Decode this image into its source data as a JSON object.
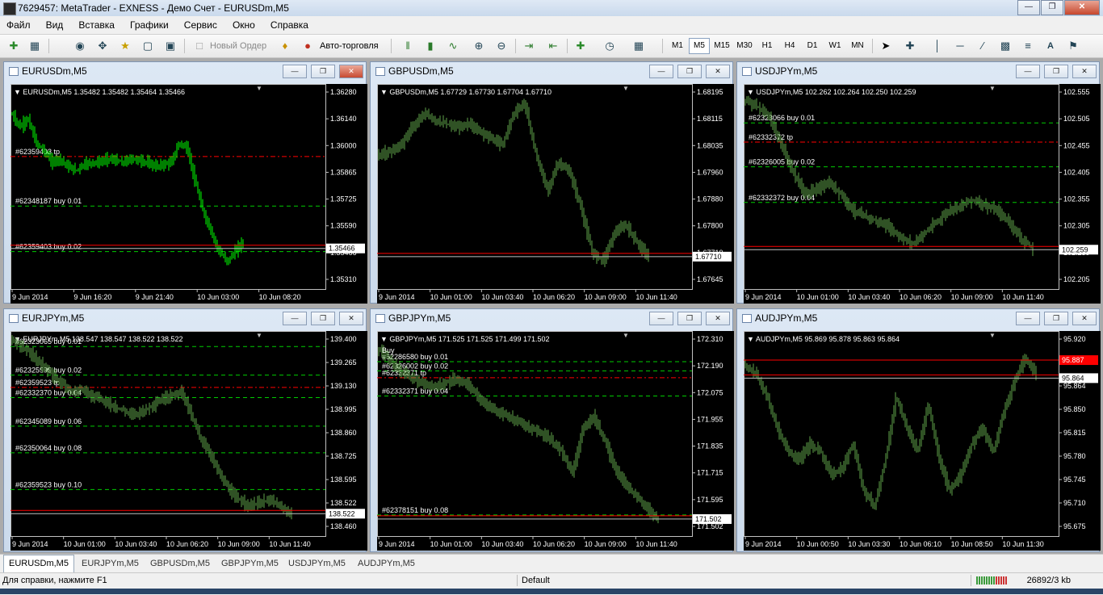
{
  "window": {
    "title": "7629457: MetaTrader - EXNESS - Демо Счет - EURUSDm,M5"
  },
  "menu": [
    "Файл",
    "Вид",
    "Вставка",
    "Графики",
    "Сервис",
    "Окно",
    "Справка"
  ],
  "toolbar": {
    "new_order": "Новый Ордер",
    "auto_trading": "Авто-торговля",
    "timeframes": [
      "M1",
      "M5",
      "M15",
      "M30",
      "H1",
      "H4",
      "D1",
      "W1",
      "MN"
    ],
    "active_timeframe": "M5"
  },
  "colors": {
    "bull": "#00ff00",
    "bear": "#00ff00",
    "chart_bg": "#000000",
    "grid": "#000000",
    "order_line": "#00cc00",
    "tp_line": "#ff0000",
    "bid_line": "#c0c0c0"
  },
  "charts": [
    {
      "title": "EURUSDm,M5",
      "info": "EURUSDm,M5  1.35482 1.35482 1.35464 1.35466",
      "line_color": "#00ff00",
      "yticks": [
        "1.36280",
        "1.36140",
        "1.36000",
        "1.35865",
        "1.35725",
        "1.35590",
        "1.35466",
        "1.35310"
      ],
      "ymin": 1.3531,
      "ymax": 1.3628,
      "xticks": [
        "9 Jun 2014",
        "9 Jun 16:20",
        "9 Jun 21:40",
        "10 Jun 03:00",
        "10 Jun 08:20"
      ],
      "price_label": "1.35466",
      "price_label_bg": "#ffffff",
      "price": 1.35466,
      "price_color": "#c0c0c0",
      "close_frac": 0.74,
      "levels": [
        {
          "label": "#62359403 tp",
          "value": 1.3593,
          "type": "tp"
        },
        {
          "label": "#62348187 buy 0.01",
          "value": 1.3568,
          "type": "order"
        },
        {
          "label": "#62359403 buy 0.02",
          "value": 1.3545,
          "type": "order"
        }
      ],
      "path": [
        1.3614,
        1.3608,
        1.3612,
        1.36,
        1.3596,
        1.359,
        1.3592,
        1.3588,
        1.3586,
        1.3589,
        1.359,
        1.359,
        1.3592,
        1.3591,
        1.359,
        1.3592,
        1.3591,
        1.359,
        1.3588,
        1.3589,
        1.359,
        1.36,
        1.3597,
        1.358,
        1.3565,
        1.3555,
        1.3545,
        1.354,
        1.3545,
        1.355
      ]
    },
    {
      "title": "GBPUSDm,M5",
      "info": "GBPUSDm,M5  1.67729 1.67730 1.67704 1.67710",
      "line_color": "#5fa44a",
      "yticks": [
        "1.68195",
        "1.68115",
        "1.68035",
        "1.67960",
        "1.67880",
        "1.67800",
        "1.67710",
        "1.67645"
      ],
      "ymin": 1.67645,
      "ymax": 1.68195,
      "xticks": [
        "9 Jun 2014",
        "10 Jun 01:00",
        "10 Jun 03:40",
        "10 Jun 06:20",
        "10 Jun 09:00",
        "10 Jun 11:40"
      ],
      "price_label": "1.67710",
      "price_label_bg": "#ffffff",
      "price": 1.6771,
      "price_color": "#c0c0c0",
      "close_frac": 0.86,
      "levels": [],
      "path": [
        1.68,
        1.6801,
        1.6803,
        1.6808,
        1.6812,
        1.681,
        1.6809,
        1.6808,
        1.6809,
        1.6807,
        1.6805,
        1.6803,
        1.6812,
        1.6815,
        1.68,
        1.679,
        1.6798,
        1.6795,
        1.6785,
        1.6772,
        1.677,
        1.6778,
        1.678,
        1.6775,
        1.6771
      ]
    },
    {
      "title": "USDJPYm,M5",
      "info": "USDJPYm,M5  102.262 102.264 102.250 102.259",
      "line_color": "#5fa44a",
      "yticks": [
        "102.555",
        "102.505",
        "102.455",
        "102.405",
        "102.355",
        "102.305",
        "102.259",
        "102.205"
      ],
      "ymin": 102.205,
      "ymax": 102.555,
      "xticks": [
        "9 Jun 2014",
        "10 Jun 01:00",
        "10 Jun 03:40",
        "10 Jun 06:20",
        "10 Jun 09:00",
        "10 Jun 11:40"
      ],
      "price_label": "102.259",
      "price_label_bg": "#ffffff",
      "price": 102.259,
      "price_color": "#c0c0c0",
      "close_frac": 0.92,
      "levels": [
        {
          "label": "#62323066 buy 0.01",
          "value": 102.49,
          "type": "order"
        },
        {
          "label": "#62332372 tp",
          "value": 102.455,
          "type": "tp"
        },
        {
          "label": "#62326005 buy 0.02",
          "value": 102.41,
          "type": "order"
        },
        {
          "label": "#62332372 buy 0.04",
          "value": 102.345,
          "type": "order"
        }
      ],
      "path": [
        102.53,
        102.52,
        102.5,
        102.45,
        102.4,
        102.36,
        102.37,
        102.38,
        102.36,
        102.33,
        102.32,
        102.31,
        102.3,
        102.28,
        102.27,
        102.29,
        102.31,
        102.33,
        102.34,
        102.35,
        102.34,
        102.33,
        102.31,
        102.28,
        102.26
      ]
    },
    {
      "title": "EURJPYm,M5",
      "info": "EURJPYm,M5  138.547 138.547 138.522 138.522",
      "line_color": "#5fa44a",
      "yticks": [
        "139.400",
        "139.265",
        "139.130",
        "138.995",
        "138.860",
        "138.725",
        "138.595",
        "138.522",
        "138.460"
      ],
      "ymin": 138.46,
      "ymax": 139.4,
      "xticks": [
        "9 Jun 2014",
        "10 Jun 01:00",
        "10 Jun 03:40",
        "10 Jun 06:20",
        "10 Jun 09:00",
        "10 Jun 11:40"
      ],
      "price_label": "138.522",
      "price_label_bg": "#ffffff",
      "price": 138.522,
      "price_color": "#c0c0c0",
      "close_frac": 0.89,
      "levels": [
        {
          "label": "#62323065 buy 0.01",
          "value": 139.34,
          "type": "order"
        },
        {
          "label": "#62325999 buy 0.02",
          "value": 139.2,
          "type": "order"
        },
        {
          "label": "#62359523 tp",
          "value": 139.14,
          "type": "tp"
        },
        {
          "label": "#62332370 buy 0.04",
          "value": 139.09,
          "type": "order"
        },
        {
          "label": "#62345089 buy 0.06",
          "value": 138.95,
          "type": "order"
        },
        {
          "label": "#62350064 buy 0.08",
          "value": 138.82,
          "type": "order"
        },
        {
          "label": "#62359523 buy 0.10",
          "value": 138.64,
          "type": "order"
        }
      ],
      "path": [
        139.37,
        139.34,
        139.3,
        139.25,
        139.2,
        139.16,
        139.12,
        139.13,
        139.1,
        139.08,
        139.05,
        139.03,
        139.01,
        139.02,
        139.05,
        139.08,
        139.1,
        139.12,
        139.0,
        138.88,
        138.8,
        138.7,
        138.62,
        138.58,
        138.56,
        138.58,
        138.59,
        138.55,
        138.52
      ]
    },
    {
      "title": "GBPJPYm,M5",
      "info": "GBPJPYm,M5  171.525 171.525 171.499 171.502",
      "line_color": "#5fa44a",
      "yticks": [
        "172.310",
        "172.190",
        "172.075",
        "171.955",
        "171.835",
        "171.715",
        "171.595",
        "171.502"
      ],
      "ymin": 171.47,
      "ymax": 172.31,
      "xticks": [
        "9 Jun 2014",
        "10 Jun 01:00",
        "10 Jun 03:40",
        "10 Jun 06:20",
        "10 Jun 09:00",
        "10 Jun 11:40"
      ],
      "price_label": "171.502",
      "price_label_bg": "#ffffff",
      "price": 171.502,
      "price_color": "#c0c0c0",
      "close_frac": 0.89,
      "levels": [
        {
          "label": "#62286580 buy 0.01",
          "value": 172.19,
          "type": "order"
        },
        {
          "label": "#62326002 buy 0.02",
          "value": 172.15,
          "type": "order"
        },
        {
          "label": "#62332371 tp",
          "value": 172.12,
          "type": "tp"
        },
        {
          "label": "#62332371 buy 0.04",
          "value": 172.04,
          "type": "order"
        },
        {
          "label": "#62378151 buy 0.08",
          "value": 171.52,
          "type": "order"
        }
      ],
      "buy_marker": "Buy",
      "path": [
        172.24,
        172.2,
        172.15,
        172.12,
        172.1,
        172.08,
        172.09,
        172.11,
        172.1,
        172.05,
        172.0,
        171.97,
        171.95,
        171.93,
        171.9,
        171.88,
        171.85,
        171.8,
        171.7,
        171.9,
        171.95,
        171.85,
        171.72,
        171.65,
        171.6,
        171.55,
        171.5
      ]
    },
    {
      "title": "AUDJPYm,M5",
      "info": "AUDJPYm,M5  95.869 95.878 95.863 95.864",
      "line_color": "#5fa44a",
      "yticks": [
        "95.920",
        "95.887",
        "95.864",
        "95.850",
        "95.815",
        "95.780",
        "95.745",
        "95.710",
        "95.675"
      ],
      "ymin": 95.675,
      "ymax": 95.92,
      "xticks": [
        "9 Jun 2014",
        "10 Jun 00:50",
        "10 Jun 03:30",
        "10 Jun 06:10",
        "10 Jun 08:50",
        "10 Jun 11:30"
      ],
      "price_label": "95.864",
      "price_label_bg": "#ffffff",
      "price": 95.864,
      "price_color": "#c0c0c0",
      "extra_label": "95.887",
      "extra_price": 95.887,
      "close_frac": 0.93,
      "levels": [],
      "path": [
        95.88,
        95.87,
        95.84,
        95.8,
        95.77,
        95.76,
        95.78,
        95.77,
        95.74,
        95.75,
        95.78,
        95.72,
        95.7,
        95.76,
        95.84,
        95.8,
        95.77,
        95.83,
        95.76,
        95.72,
        95.74,
        95.78,
        95.8,
        95.77,
        95.82,
        95.86,
        95.89,
        95.87
      ]
    }
  ],
  "tabs": [
    "EURUSDm,M5",
    "EURJPYm,M5",
    "GBPUSDm,M5",
    "GBPJPYm,M5",
    "USDJPYm,M5",
    "AUDJPYm,M5"
  ],
  "status": {
    "help": "Для справки, нажмите F1",
    "profile": "Default",
    "traffic": "26892/3 kb"
  }
}
